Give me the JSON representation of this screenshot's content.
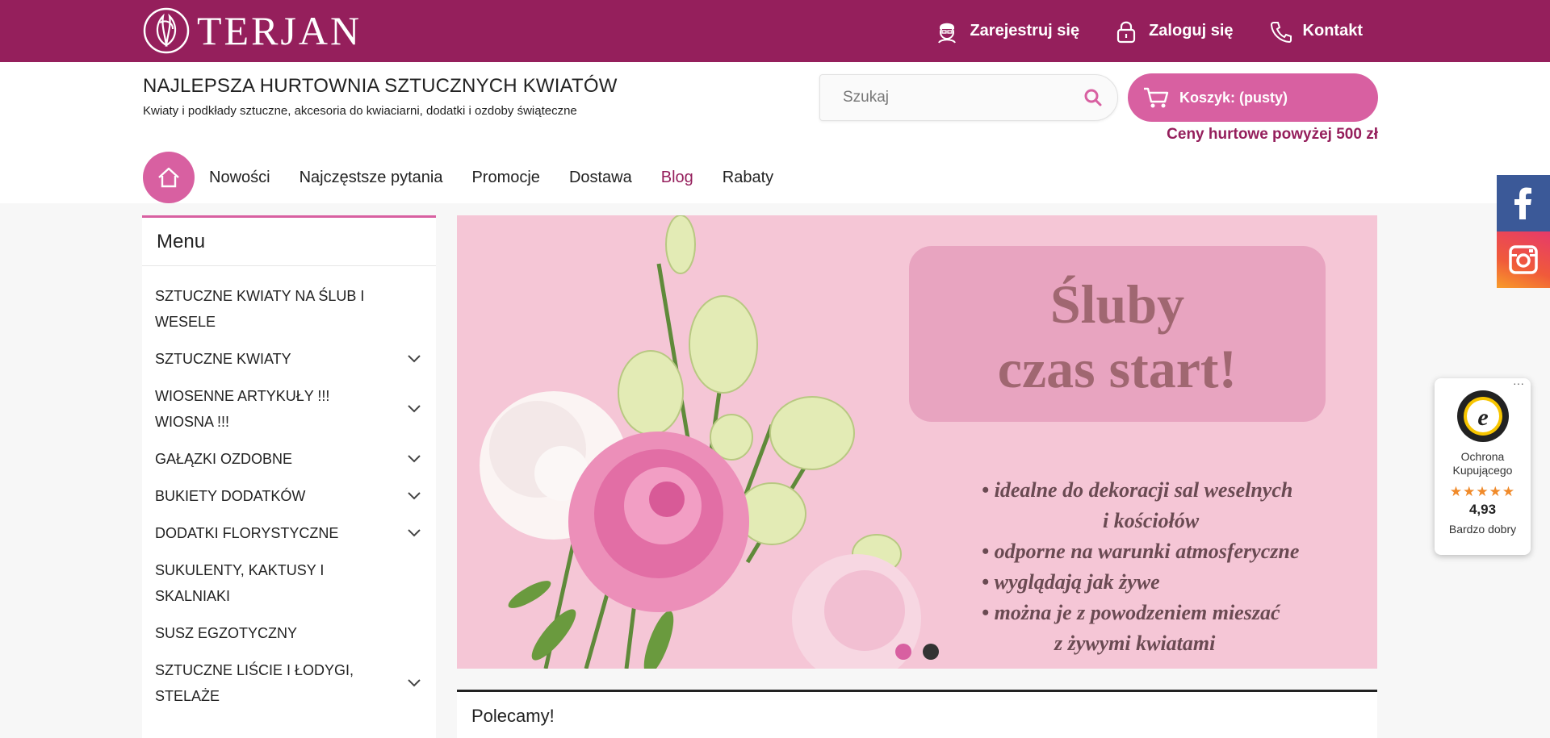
{
  "brand": {
    "name": "TERJAN"
  },
  "topbar": {
    "links": [
      {
        "label": "Zarejestruj się",
        "icon": "user-icon"
      },
      {
        "label": "Zaloguj się",
        "icon": "lock-icon"
      },
      {
        "label": "Kontakt",
        "icon": "phone-icon"
      }
    ]
  },
  "header": {
    "title": "NAJLEPSZA HURTOWNIA SZTUCZNYCH KWIATÓW",
    "subtitle": "Kwiaty i podkłady sztuczne, akcesoria do kwiaciarni, dodatki i ozdoby świąteczne",
    "search_placeholder": "Szukaj",
    "cart_label": "Koszyk: (pusty)",
    "wholesale_note": "Ceny hurtowe powyżej 500 zł"
  },
  "nav": {
    "items": [
      {
        "label": "Nowości"
      },
      {
        "label": "Najczęstsze pytania"
      },
      {
        "label": "Promocje"
      },
      {
        "label": "Dostawa"
      },
      {
        "label": "Blog",
        "active": true
      },
      {
        "label": "Rabaty"
      }
    ]
  },
  "sidebar": {
    "title": "Menu",
    "items": [
      {
        "label": "SZTUCZNE KWIATY NA ŚLUB I WESELE",
        "has_children": false
      },
      {
        "label": "SZTUCZNE KWIATY",
        "has_children": true
      },
      {
        "label": "WIOSENNE ARTYKUŁY !!! WIOSNA !!!",
        "has_children": true
      },
      {
        "label": "GAŁĄZKI OZDOBNE",
        "has_children": true
      },
      {
        "label": "BUKIETY DODATKÓW",
        "has_children": true
      },
      {
        "label": "DODATKI FLORYSTYCZNE",
        "has_children": true
      },
      {
        "label": "SUKULENTY, KAKTUSY I SKALNIAKI",
        "has_children": false
      },
      {
        "label": "SUSZ EGZOTYCZNY",
        "has_children": false
      },
      {
        "label": "SZTUCZNE LIŚCIE I ŁODYGI, STELAŻE",
        "has_children": true
      }
    ]
  },
  "slider": {
    "headline_line1": "Śluby",
    "headline_line2": "czas start!",
    "bullets": [
      "• idealne do dekoracji sal weselnych",
      "i kościołów",
      "• odporne na warunki atmosferyczne",
      "• wyglądają jak żywe",
      "• można je z powodzeniem mieszać",
      "z żywymi kwiatami"
    ],
    "slide_count": 2,
    "active_slide": 1
  },
  "recommended": {
    "title": "Polecamy!"
  },
  "trusted_shops": {
    "more": "···",
    "label_line1": "Ochrona",
    "label_line2": "Kupującego",
    "stars": "★★★★★",
    "score": "4,93",
    "verdict": "Bardzo dobry"
  },
  "colors": {
    "brand": "#951f5c",
    "accent": "#d860a1",
    "facebook": "#3b5998"
  }
}
